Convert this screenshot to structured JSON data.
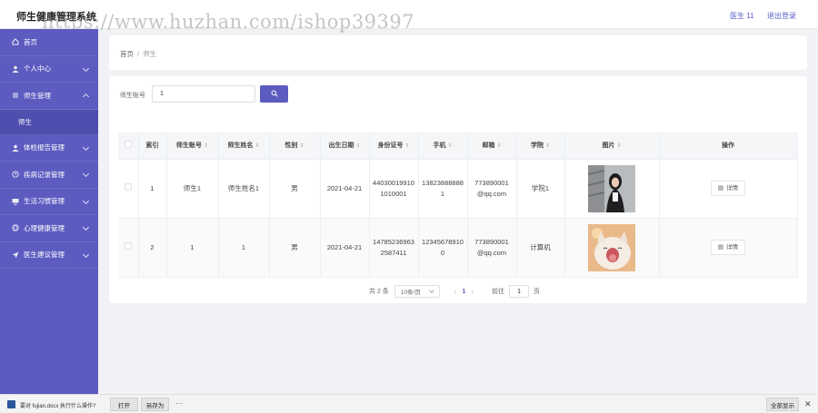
{
  "app": {
    "title": "师生健康管理系统"
  },
  "watermark": "https://www.huzhan.com/ishop39397",
  "topbar": {
    "user": "医生 11",
    "logout": "退出登录"
  },
  "sidebar": {
    "items": [
      {
        "label": "首页",
        "icon": "home-icon"
      },
      {
        "label": "个人中心",
        "icon": "user-icon"
      },
      {
        "label": "师生管理",
        "icon": "list-icon",
        "expanded": true
      },
      {
        "label": "体检报告管理",
        "icon": "person-icon"
      },
      {
        "label": "疾病记录管理",
        "icon": "clock-icon"
      },
      {
        "label": "生活习惯管理",
        "icon": "monitor-icon"
      },
      {
        "label": "心理健康管理",
        "icon": "globe-icon"
      },
      {
        "label": "医生建议管理",
        "icon": "send-icon"
      }
    ],
    "sub_item": "师生"
  },
  "breadcrumb": {
    "home": "首页",
    "separator": "/",
    "current": "师生"
  },
  "search": {
    "label": "师生账号",
    "value": "1"
  },
  "table": {
    "headers": [
      "索引",
      "师生账号",
      "师生姓名",
      "性别",
      "出生日期",
      "身份证号",
      "手机",
      "邮箱",
      "学院",
      "图片",
      "操作"
    ],
    "rows": [
      {
        "index": "1",
        "account": "师生1",
        "name": "师生姓名1",
        "gender": "男",
        "birth": "2021-04-21",
        "id_line1": "44030019910",
        "id_line2": "1010001",
        "phone_line1": "13823888888",
        "phone_line2": "1",
        "email_line1": "773890001",
        "email_line2": "@qq.com",
        "college": "学院1",
        "photo": "photo-of-woman",
        "action": "详情"
      },
      {
        "index": "2",
        "account": "1",
        "name": "1",
        "gender": "男",
        "birth": "2021-04-21",
        "id_line1": "14785236963",
        "id_line2": "2587411",
        "phone_line1": "12345678910",
        "phone_line2": "0",
        "email_line1": "773890001",
        "email_line2": "@qq.com",
        "college": "计算机",
        "photo": "photo-of-yawning-cat",
        "action": "详情"
      }
    ]
  },
  "pagination": {
    "total": "共 2 条",
    "page_size": "10条/页",
    "current_page": "1",
    "goto": "前往",
    "jump_value": "1",
    "page_unit": "页"
  },
  "download_bar": {
    "message": "要对 fujian.docx 执行什么操作?",
    "open": "打开",
    "save_as": "另存为",
    "more": "···",
    "show_all": "全部显示",
    "close": "✕"
  },
  "colors": {
    "accent": "#5b5bc0",
    "sidebar_bg": "#5b5bc0"
  }
}
